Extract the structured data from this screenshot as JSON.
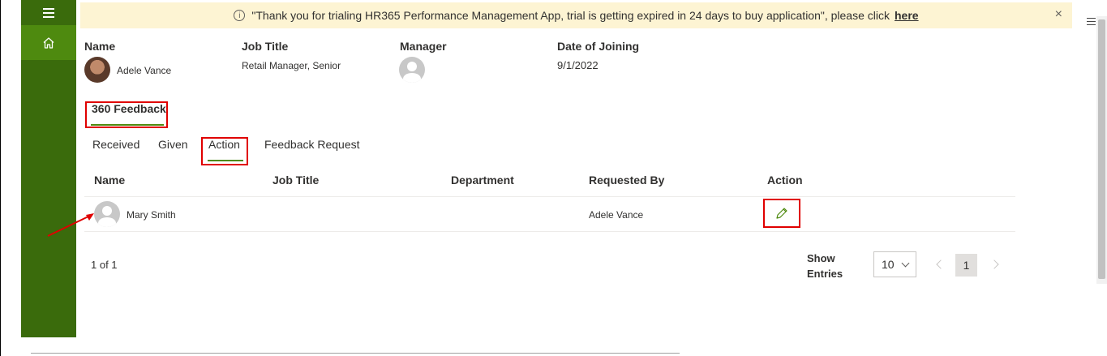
{
  "banner": {
    "message": "\"Thank you for trialing HR365 Performance Management App, trial is getting expired in 24 days to buy application\", please click",
    "link": "here",
    "close": "×"
  },
  "profile": {
    "name_label": "Name",
    "name": "Adele Vance",
    "job_title_label": "Job Title",
    "job_title": "Retail Manager, Senior",
    "manager_label": "Manager",
    "doj_label": "Date of Joining",
    "doj": "9/1/2022"
  },
  "main_tab": "360 Feedback",
  "subtabs": {
    "received": "Received",
    "given": "Given",
    "action": "Action",
    "feedback_request": "Feedback Request"
  },
  "table": {
    "headers": [
      "Name",
      "Job Title",
      "Department",
      "Requested By",
      "Action"
    ],
    "rows": [
      {
        "name": "Mary Smith",
        "job_title": "",
        "department": "",
        "requested_by": "Adele Vance",
        "action": "edit-icon"
      }
    ]
  },
  "pagination": {
    "summary": "1 of 1",
    "show_entries_line1": "Show",
    "show_entries_line2": "Entries",
    "page_size": "10",
    "current_page": "1"
  },
  "colors": {
    "sidebar": "#3a6b0c",
    "sidebar_active": "#4e8a0f",
    "banner_bg": "#fdf4d3",
    "accent": "#4e8a0f",
    "annotation_red": "#e00000"
  }
}
